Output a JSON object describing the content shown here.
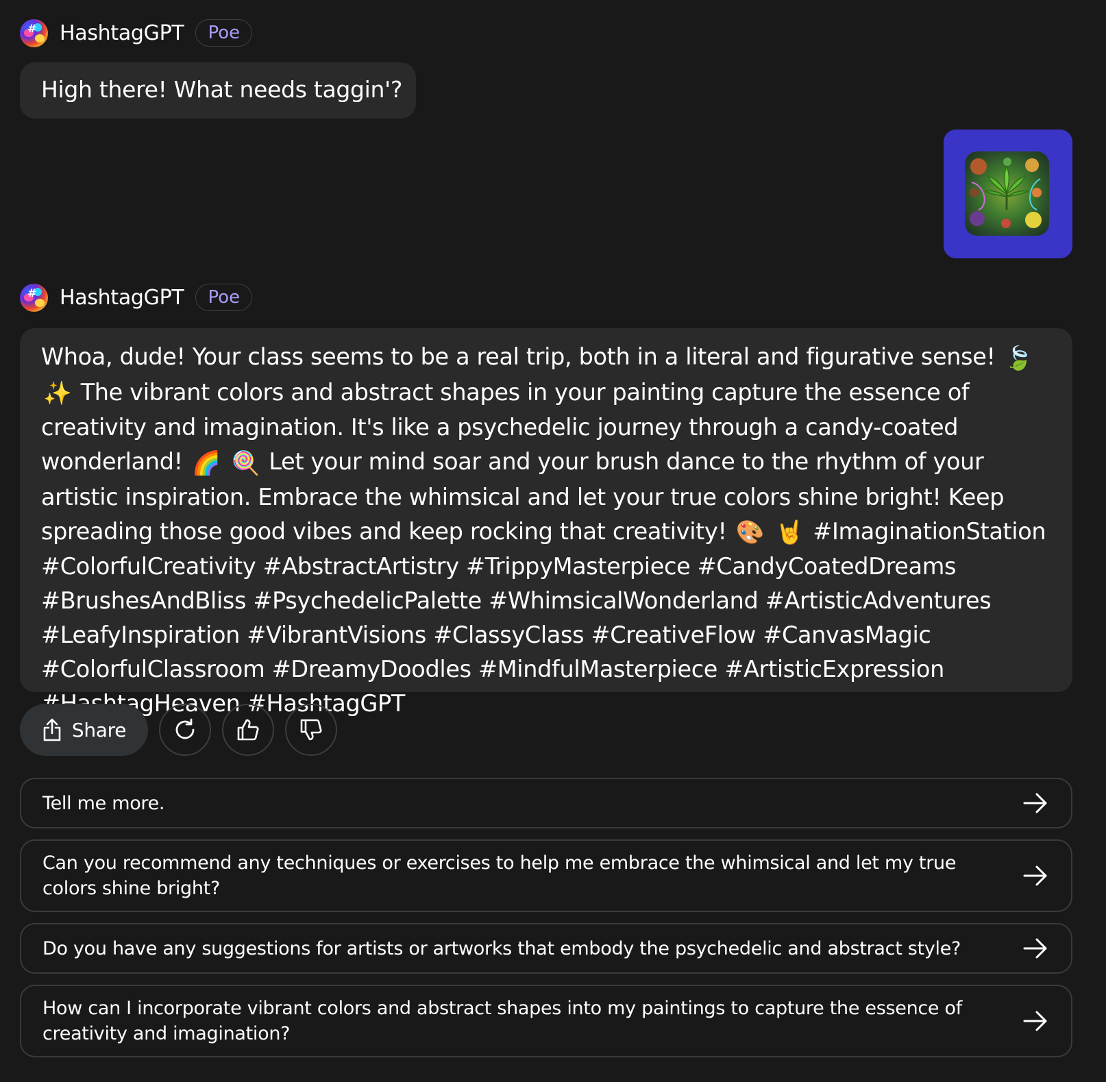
{
  "bot": {
    "name": "HashtagGPT",
    "badge": "Poe",
    "avatar_icon": "hashtaggpt-avatar"
  },
  "messages": {
    "greeting": "High there! What needs taggin'?",
    "user_image_icon": "cannabis-psychedelic-painting-thumbnail",
    "response": {
      "part1": "Whoa, dude! Your class seems to be a real trip, both in a literal and figurative sense!",
      "emoji1": "🍃",
      "emoji2": "✨",
      "part2": "The vibrant colors and abstract shapes in your painting capture the essence of creativity and imagination. It's like a psychedelic journey through a candy-coated wonderland!",
      "emoji3": "🌈",
      "emoji4": "🍭",
      "part3": "Let your mind soar and your brush dance to the rhythm of your artistic inspiration. Embrace the whimsical and let your true colors shine bright! Keep spreading those good vibes and keep rocking that creativity!",
      "emoji5": "🎨",
      "emoji6": "🤘",
      "hashtags": "#ImaginationStation #ColorfulCreativity #AbstractArtistry #TrippyMasterpiece #CandyCoatedDreams #BrushesAndBliss #PsychedelicPalette #WhimsicalWonderland #ArtisticAdventures #LeafyInspiration #VibrantVisions #ClassyClass #CreativeFlow #CanvasMagic #ColorfulClassroom #DreamyDoodles #MindfulMasterpiece #ArtisticExpression #HashtagHeaven #HashtagGPT"
    }
  },
  "actions": {
    "share_label": "Share",
    "share_icon": "share-icon",
    "retry_icon": "retry-icon",
    "like_icon": "thumbs-up-icon",
    "dislike_icon": "thumbs-down-icon"
  },
  "suggestions": [
    {
      "text": "Tell me more.",
      "icon": "arrow-right-icon"
    },
    {
      "text": "Can you recommend any techniques or exercises to help me embrace the whimsical and let my true colors shine bright?",
      "icon": "arrow-right-icon"
    },
    {
      "text": "Do you have any suggestions for artists or artworks that embody the psychedelic and abstract style?",
      "icon": "arrow-right-icon"
    },
    {
      "text": "How can I incorporate vibrant colors and abstract shapes into my paintings to capture the essence of creativity and imagination?",
      "icon": "arrow-right-icon"
    }
  ],
  "colors": {
    "background": "#191919",
    "bubble": "#2a2a2a",
    "badge_text": "#a79cf6",
    "user_bubble": "#3b35c7"
  }
}
